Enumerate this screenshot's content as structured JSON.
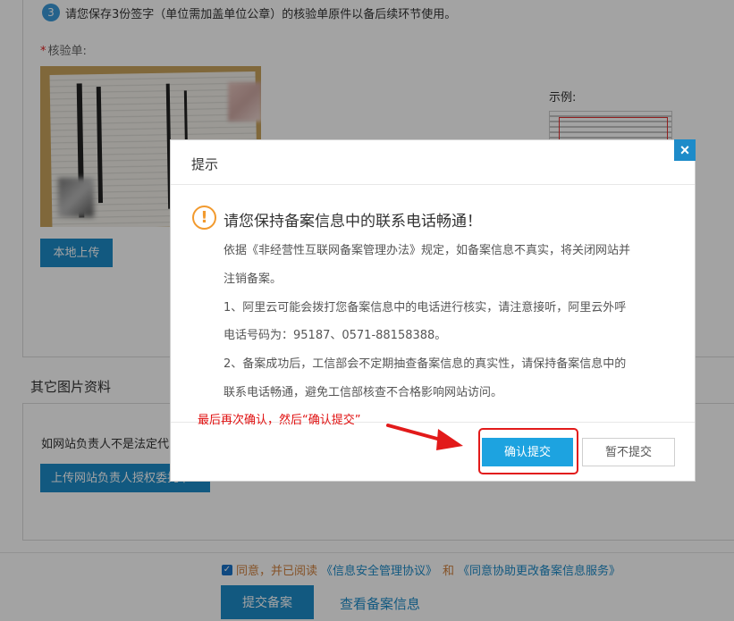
{
  "background": {
    "step3": {
      "num": "3",
      "text": "请您保存3份签字（单位需加盖单位公章）的核验单原件以备后续环节使用。"
    },
    "verify_label_req": "*",
    "verify_label": "核验单:",
    "upload_local_label": "本地上传",
    "example_label": "示例:",
    "other_images_title": "其它图片资料",
    "other_desc": "如网站负责人不是法定代",
    "upload_auth_label": "上传网站负责人授权委托书",
    "agree_text": "同意，并已阅读",
    "agree_link1": "《信息安全管理协议》",
    "agree_and": "和",
    "agree_link2": "《同意协助更改备案信息服务》",
    "submit_label": "提交备案",
    "view_label": "查看备案信息"
  },
  "dialog": {
    "title": "提示",
    "close_label": "×",
    "warn_glyph": "!",
    "main_message": "请您保持备案信息中的联系电话畅通！",
    "lines": [
      "依据《非经营性互联网备案管理办法》规定，如备案信息不真实，将关闭网站并",
      "注销备案。",
      "1、阿里云可能会拨打您备案信息中的电话进行核实，请注意接听，阿里云外呼",
      "电话号码为：95187、0571-88158388。",
      "2、备案成功后，工信部会不定期抽查备案信息的真实性，请保持备案信息中的",
      "联系电话畅通，避免工信部核查不合格影响网站访问。"
    ],
    "confirm_label": "确认提交",
    "later_label": "暂不提交"
  },
  "annotation": "最后再次确认，然后“确认提交”",
  "colors": {
    "primary": "#1d8bc9",
    "confirm": "#1da3e0",
    "warning": "#f29a2e",
    "annotation_red": "#e01010"
  }
}
